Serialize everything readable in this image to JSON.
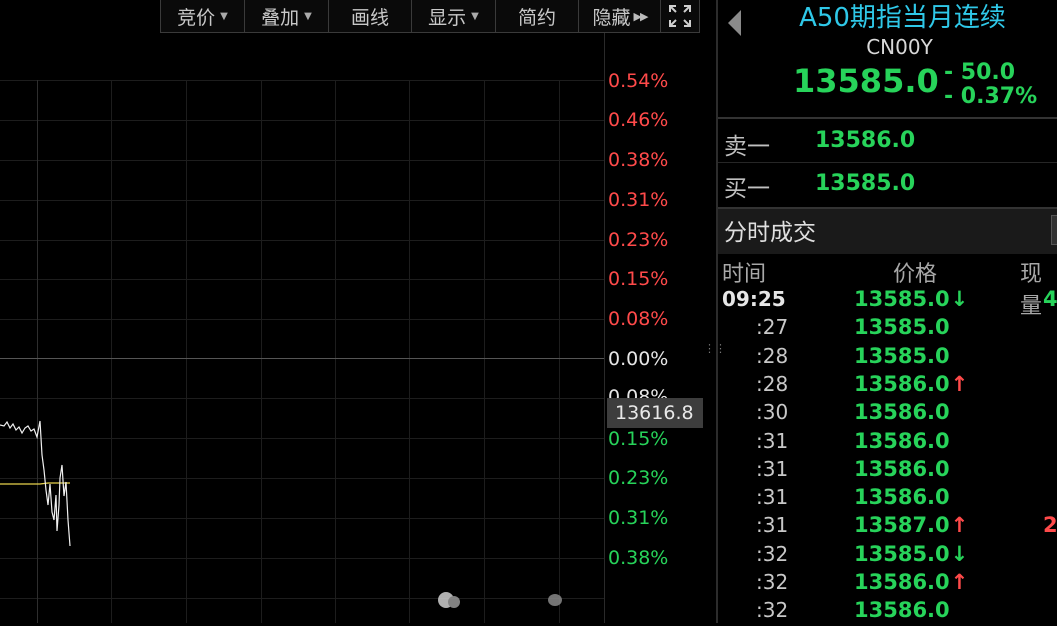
{
  "toolbar": {
    "items": [
      {
        "label": "竞价",
        "has_dropdown": true
      },
      {
        "label": "叠加",
        "has_dropdown": true
      },
      {
        "label": "画线",
        "has_dropdown": false
      },
      {
        "label": "显示",
        "has_dropdown": true
      },
      {
        "label": "简约",
        "has_dropdown": false
      },
      {
        "label": "隐藏",
        "has_dropdown": false
      }
    ],
    "fullscreen_icon": "fullscreen-icon"
  },
  "chart": {
    "pct_labels": [
      {
        "text": "0.54%",
        "color": "red"
      },
      {
        "text": "0.46%",
        "color": "red"
      },
      {
        "text": "0.38%",
        "color": "red"
      },
      {
        "text": "0.31%",
        "color": "red"
      },
      {
        "text": "0.23%",
        "color": "red"
      },
      {
        "text": "0.15%",
        "color": "red"
      },
      {
        "text": "0.08%",
        "color": "red"
      },
      {
        "text": "0.00%",
        "color": "white"
      },
      {
        "text": "0.08%",
        "color": "white-partial"
      },
      {
        "text": "0.15%",
        "color": "green"
      },
      {
        "text": "0.23%",
        "color": "green"
      },
      {
        "text": "0.31%",
        "color": "green"
      },
      {
        "text": "0.38%",
        "color": "green"
      }
    ],
    "cursor_price": "13616.8",
    "colors": {
      "up": "#ff4a4a",
      "down": "#27d35a",
      "line": "#ffffff",
      "avg_line": "#e8d44d"
    }
  },
  "quote": {
    "title": "A50期指当月连续",
    "code": "CN00Y",
    "price": "13585.0",
    "change": "- 50.0",
    "change_pct": "- 0.37%"
  },
  "orderbook": {
    "sell1_label": "卖一",
    "sell1_price": "13586.0",
    "buy1_label": "买一",
    "buy1_price": "13585.0"
  },
  "trades": {
    "section_title": "分时成交",
    "headers": {
      "time": "时间",
      "price": "价格",
      "volume": "现量"
    },
    "rows": [
      {
        "time": "09:25",
        "full": true,
        "price": "13585.0",
        "arrow": "down",
        "vol": "4",
        "vol_color": "green"
      },
      {
        "time": ":27",
        "full": false,
        "price": "13585.0",
        "arrow": "",
        "vol": "",
        "vol_color": ""
      },
      {
        "time": ":28",
        "full": false,
        "price": "13585.0",
        "arrow": "",
        "vol": "",
        "vol_color": ""
      },
      {
        "time": ":28",
        "full": false,
        "price": "13586.0",
        "arrow": "up",
        "vol": "",
        "vol_color": ""
      },
      {
        "time": ":30",
        "full": false,
        "price": "13586.0",
        "arrow": "",
        "vol": "",
        "vol_color": ""
      },
      {
        "time": ":31",
        "full": false,
        "price": "13586.0",
        "arrow": "",
        "vol": "",
        "vol_color": ""
      },
      {
        "time": ":31",
        "full": false,
        "price": "13586.0",
        "arrow": "",
        "vol": "",
        "vol_color": ""
      },
      {
        "time": ":31",
        "full": false,
        "price": "13586.0",
        "arrow": "",
        "vol": "",
        "vol_color": ""
      },
      {
        "time": ":31",
        "full": false,
        "price": "13587.0",
        "arrow": "up",
        "vol": "2",
        "vol_color": "red"
      },
      {
        "time": ":32",
        "full": false,
        "price": "13585.0",
        "arrow": "down",
        "vol": "",
        "vol_color": ""
      },
      {
        "time": ":32",
        "full": false,
        "price": "13586.0",
        "arrow": "up",
        "vol": "",
        "vol_color": ""
      },
      {
        "time": ":32",
        "full": false,
        "price": "13586.0",
        "arrow": "",
        "vol": "",
        "vol_color": ""
      }
    ]
  }
}
